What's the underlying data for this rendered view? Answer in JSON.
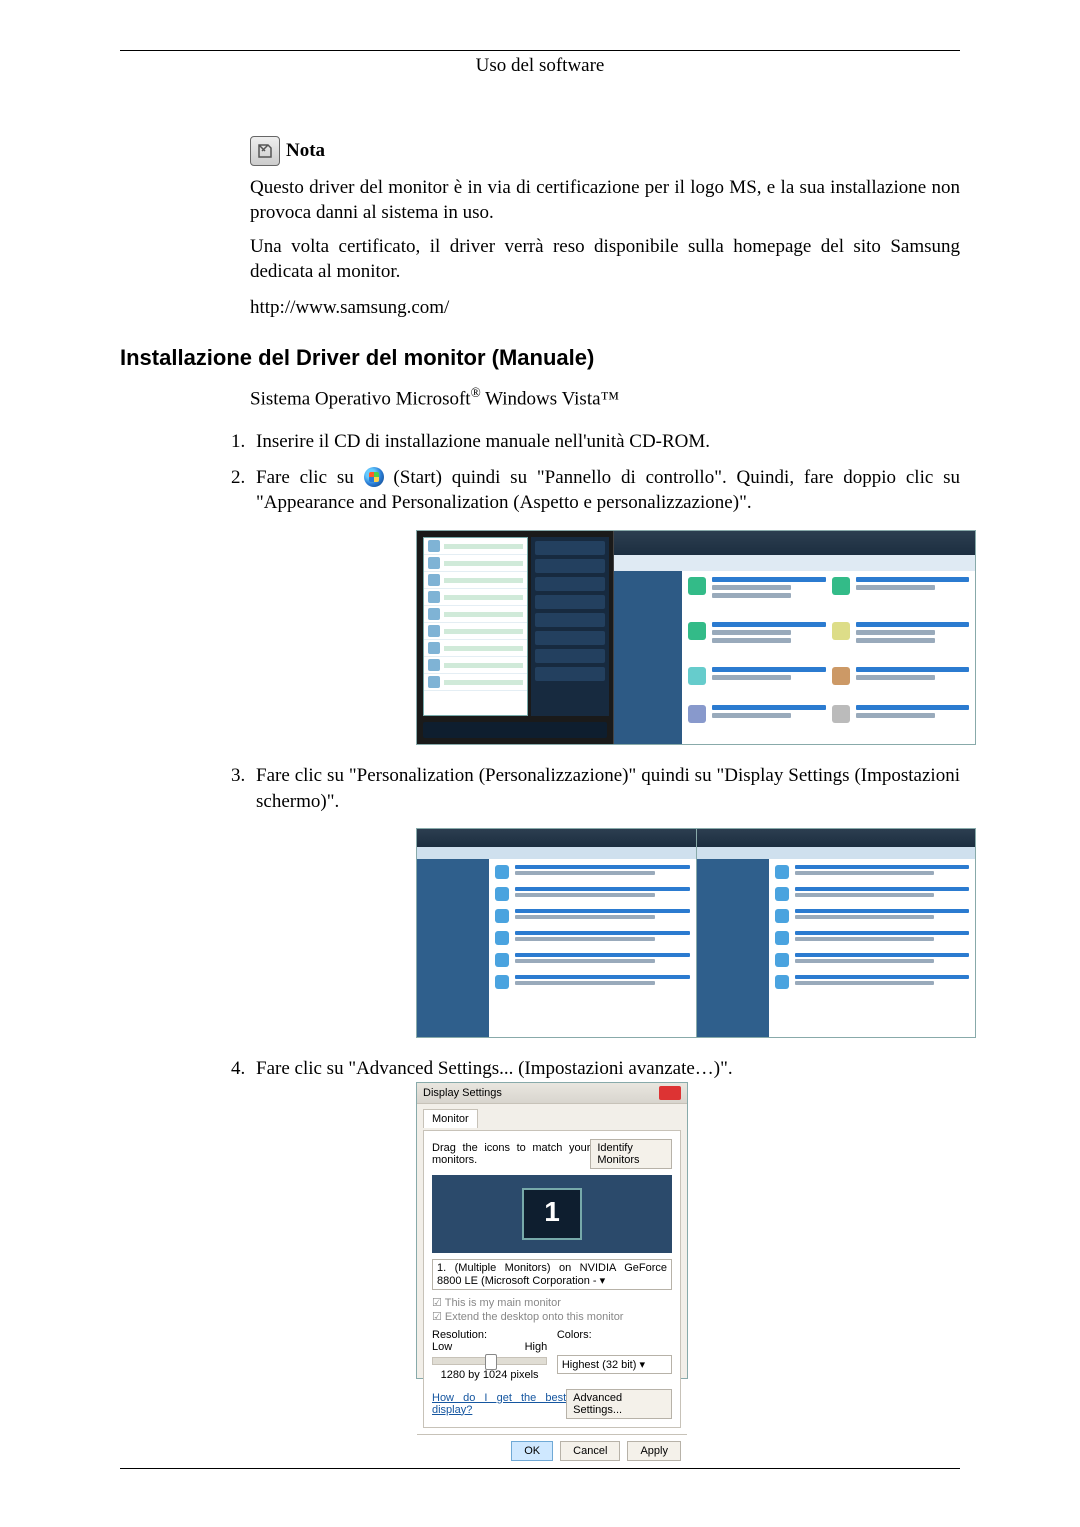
{
  "header": {
    "title": "Uso del software"
  },
  "note": {
    "label": "Nota",
    "p1": "Questo driver del monitor è in via di certificazione per il logo MS, e la sua installazione non provoca danni al sistema in uso.",
    "p2": "Una volta certificato, il driver verrà reso disponibile sulla homepage del sito Samsung dedicata al monitor.",
    "url": "http://www.samsung.com/"
  },
  "section": {
    "title": "Installazione del Driver del monitor (Manuale)",
    "os_line_prefix": "Sistema Operativo Microsoft",
    "os_line_suffix": " Windows Vista™",
    "steps": {
      "s1": "Inserire il CD di installazione manuale nell'unità CD-ROM.",
      "s2a": "Fare clic su ",
      "s2b": "(Start) quindi su \"Pannello di controllo\". Quindi, fare doppio clic su \"Appearance and Personalization (Aspetto e personalizzazione)\".",
      "s3": "Fare clic su \"Personalization (Personalizzazione)\" quindi su \"Display Settings (Impostazioni schermo)\".",
      "s4": "Fare clic su \"Advanced Settings... (Impostazioni avanzate…)\"."
    }
  },
  "fig3": {
    "title": "Display Settings",
    "tab": "Monitor",
    "hint": "Drag the icons to match your monitors.",
    "identify": "Identify Monitors",
    "monitor_number": "1",
    "combo": "1. (Multiple Monitors) on NVIDIA GeForce 8800 LE (Microsoft Corporation - ▾",
    "chk1": "☑ This is my main monitor",
    "chk2": "☑ Extend the desktop onto this monitor",
    "res_label": "Resolution:",
    "low": "Low",
    "high": "High",
    "res_value": "1280 by 1024 pixels",
    "col_label": "Colors:",
    "col_value": "Highest (32 bit)   ▾",
    "help_link": "How do I get the best display?",
    "adv_btn": "Advanced Settings...",
    "ok": "OK",
    "cancel": "Cancel",
    "apply": "Apply"
  }
}
